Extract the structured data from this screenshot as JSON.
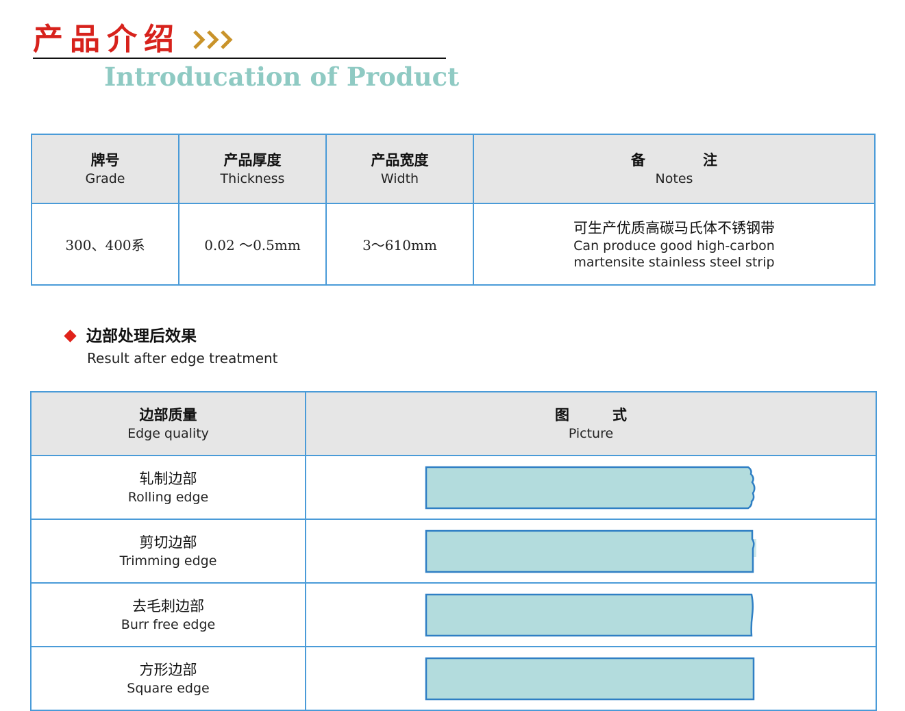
{
  "header": {
    "title_cn": "产品介绍",
    "title_en": "Introducation of Product",
    "accent_color": "#d7221c",
    "subtitle_color": "#8fcac3",
    "arrow_icon": "triple-chevron-right-icon"
  },
  "spec_table": {
    "headers": [
      {
        "cn": "牌号",
        "en": "Grade"
      },
      {
        "cn": "产品厚度",
        "en": "Thickness"
      },
      {
        "cn": "产品宽度",
        "en": "Width"
      },
      {
        "cn": "备　　　　注",
        "en": "Notes"
      }
    ],
    "row": {
      "grade": "300、400系",
      "thickness": "0.02 ～0.5mm",
      "width": "3～610mm",
      "notes_cn": "可生产优质高碳马氏体不锈钢带",
      "notes_en_1": "Can produce good high-carbon",
      "notes_en_2": "martensite stainless steel strip"
    }
  },
  "edge_section": {
    "title_cn": "边部处理后效果",
    "title_en": "Result after edge treatment",
    "bullet_color": "#e0221a"
  },
  "edge_table": {
    "headers": [
      {
        "cn": "边部质量",
        "en": "Edge quality"
      },
      {
        "cn": "图　　　式",
        "en": "Picture"
      }
    ],
    "rows": [
      {
        "cn": "轧制边部",
        "en": "Rolling edge",
        "picture": "rolling-edge-strip"
      },
      {
        "cn": "剪切边部",
        "en": "Trimming edge",
        "picture": "trimming-edge-strip"
      },
      {
        "cn": "去毛刺边部",
        "en": "Burr free edge",
        "picture": "burr-free-edge-strip"
      },
      {
        "cn": "方形边部",
        "en": "Square edge",
        "picture": "square-edge-strip"
      }
    ]
  },
  "colors": {
    "table_border": "#4a9bd8",
    "header_bg": "#e6e6e6",
    "strip_fill": "#b3dcdd",
    "strip_stroke": "#2f7fc4"
  }
}
